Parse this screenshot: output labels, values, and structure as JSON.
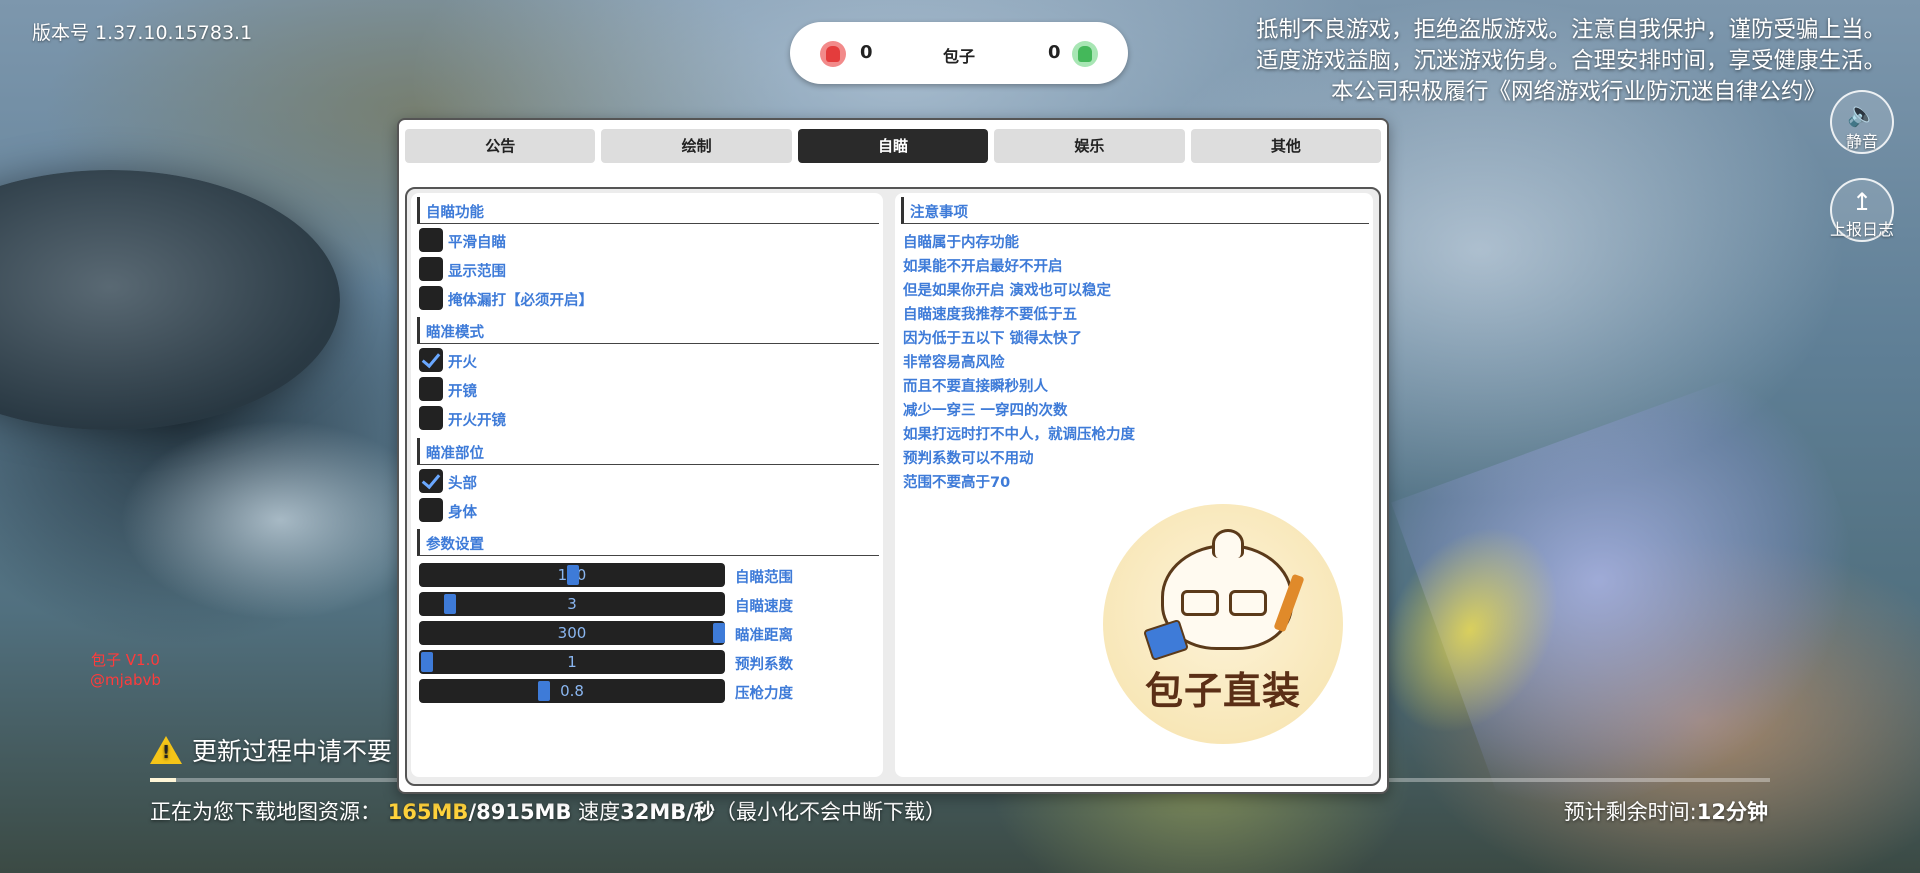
{
  "version": "版本号 1.37.10.15783.1",
  "scoreboard": {
    "left_score": "0",
    "name": "包子",
    "right_score": "0"
  },
  "notice": [
    "抵制不良游戏，拒绝盗版游戏。注意自我保护，谨防受骗上当。",
    "适度游戏益脑，沉迷游戏伤身。合理安排时间，享受健康生活。",
    "本公司积极履行《网络游戏行业防沉迷自律公约》"
  ],
  "side_buttons": {
    "mute_label": "静音",
    "report_label": "上报日志"
  },
  "watermark": {
    "line1": "包子 V1.0",
    "line2": "@mjabvb"
  },
  "download": {
    "warning": "更新过程中请不要",
    "prefix": "正在为您下载地图资源：",
    "downloaded": "165MB",
    "total": "/8915MB",
    "speed_label": "速度",
    "speed": "32MB/秒",
    "note": "（最小化不会中断下载）",
    "eta_label": "预计剩余时间:",
    "eta": "12分钟",
    "progress": 0.016
  },
  "panel": {
    "tabs": [
      "公告",
      "绘制",
      "自瞄",
      "娱乐",
      "其他"
    ],
    "active_tab": "自瞄",
    "sections": {
      "aim": "自瞄功能",
      "mode": "瞄准模式",
      "part": "瞄准部位",
      "params": "参数设置"
    },
    "aim_options": [
      {
        "label": "平滑自瞄",
        "checked": false
      },
      {
        "label": "显示范围",
        "checked": false
      },
      {
        "label": "掩体漏打【必须开启】",
        "checked": false
      }
    ],
    "mode_options": [
      {
        "label": "开火",
        "checked": true
      },
      {
        "label": "开镜",
        "checked": false
      },
      {
        "label": "开火开镜",
        "checked": false
      }
    ],
    "part_options": [
      {
        "label": "头部",
        "checked": true
      },
      {
        "label": "身体",
        "checked": false
      }
    ],
    "sliders": [
      {
        "label": "自瞄范围",
        "value": "100",
        "fraction": 0.5
      },
      {
        "label": "自瞄速度",
        "value": "3",
        "fraction": 0.08
      },
      {
        "label": "瞄准距离",
        "value": "300",
        "fraction": 1.0
      },
      {
        "label": "预判系数",
        "value": "1",
        "fraction": 0.0
      },
      {
        "label": "压枪力度",
        "value": "0.8",
        "fraction": 0.4
      }
    ],
    "notes_title": "注意事项",
    "notes": [
      "自瞄属于内存功能",
      "如果能不开启最好不开启",
      "但是如果你开启 演戏也可以稳定",
      "自瞄速度我推荐不要低于五",
      "因为低于五以下 锁得太快了",
      "非常容易高风险",
      "而且不要直接瞬秒别人",
      "减少一穿三 一穿四的次数",
      "如果打远时打不中人，就调压枪力度",
      "预判系数可以不用动",
      "范围不要高于70"
    ],
    "logo_text": "包子直装"
  }
}
